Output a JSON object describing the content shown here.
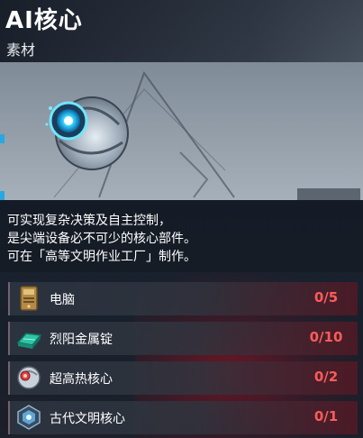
{
  "header": {
    "title": "AI核心",
    "subtitle": "素材"
  },
  "item": {
    "icon": "ai-core-sphere-icon",
    "description_lines": [
      "可实现复杂决策及自主控制，",
      "是尖端设备必不可少的核心部件。",
      "可在「高等文明作业工厂」制作。"
    ]
  },
  "materials": [
    {
      "name": "电脑",
      "owned": "0",
      "required": "5",
      "count": "0/5",
      "icon": "computer-icon"
    },
    {
      "name": "烈阳金属锭",
      "owned": "0",
      "required": "10",
      "count": "0/10",
      "icon": "metal-ingot-icon"
    },
    {
      "name": "超高热核心",
      "owned": "0",
      "required": "2",
      "count": "0/2",
      "icon": "heat-core-icon"
    },
    {
      "name": "古代文明核心",
      "owned": "0",
      "required": "1",
      "count": "0/1",
      "icon": "ancient-core-icon"
    }
  ],
  "colors": {
    "count_insufficient": "#ff5b5b",
    "accent_blue": "#27a8e0"
  }
}
